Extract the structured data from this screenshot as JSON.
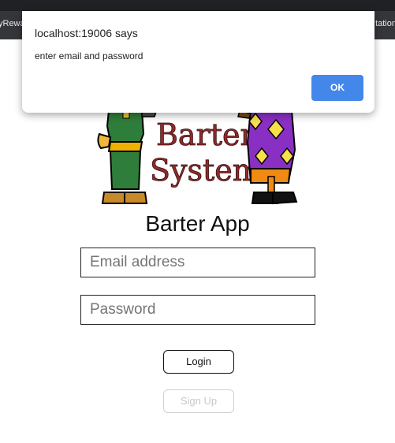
{
  "browser": {
    "bookmark_left": "yRewa",
    "bookmark_right": "tation"
  },
  "alert": {
    "title": "localhost:19006 says",
    "message": "enter email and password",
    "ok_label": "OK"
  },
  "logo": {
    "line1": "Barter",
    "line2": "System"
  },
  "app": {
    "title": "Barter App",
    "email_placeholder": "Email address",
    "password_placeholder": "Password",
    "login_label": "Login",
    "signup_label": "Sign Up"
  }
}
